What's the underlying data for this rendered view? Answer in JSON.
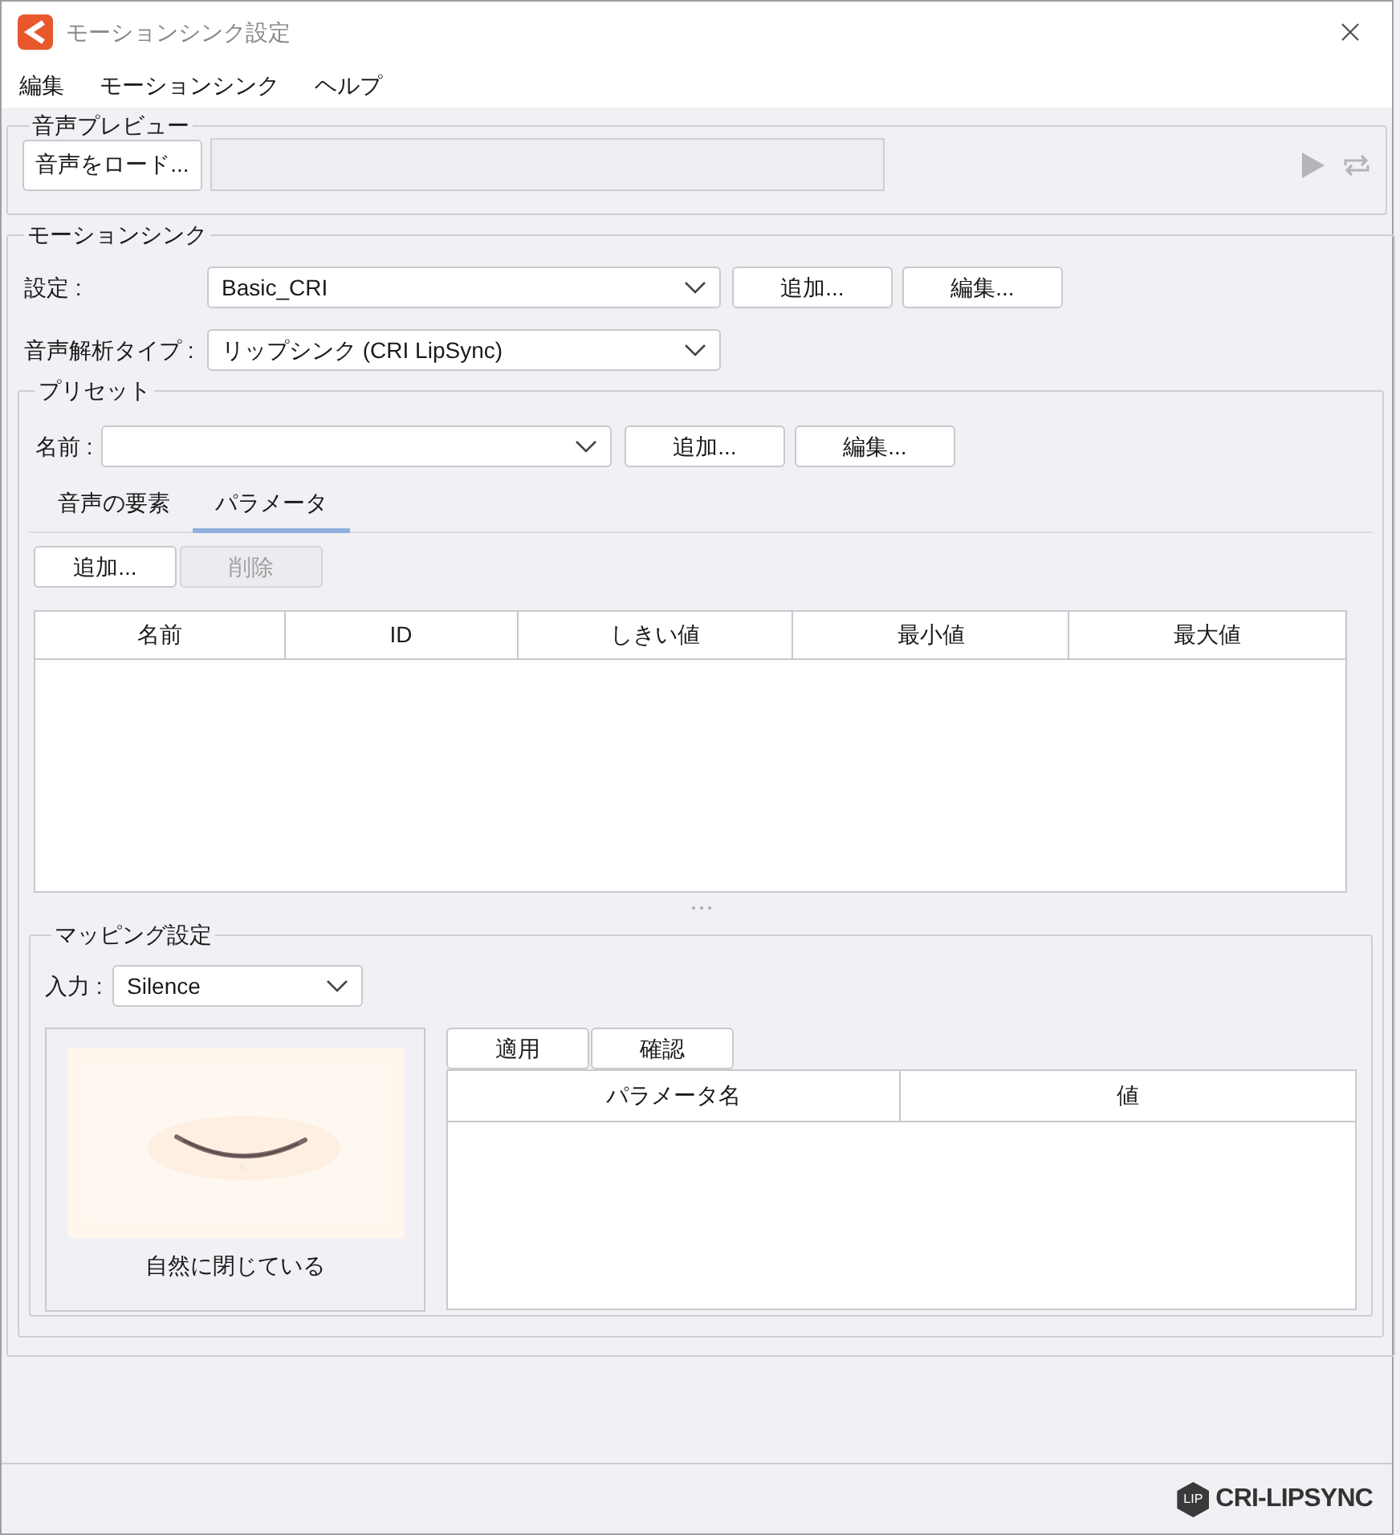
{
  "window": {
    "title": "モーションシンク設定"
  },
  "menu": [
    {
      "label": "編集"
    },
    {
      "label": "モーションシンク"
    },
    {
      "label": "ヘルプ"
    }
  ],
  "audio_preview": {
    "title": "音声プレビュー",
    "load_button": "音声をロード..."
  },
  "motion_sync": {
    "title": "モーションシンク",
    "settings": {
      "label": "設定 :",
      "value": "Basic_CRI",
      "buttons": [
        "追加...",
        "編集..."
      ]
    },
    "analysis_type": {
      "label": "音声解析タイプ :",
      "value": "リップシンク (CRI LipSync)"
    },
    "preset": {
      "title": "プリセット",
      "name_label": "名前 :",
      "buttons": [
        "追加...",
        "編集..."
      ],
      "tabs": [
        {
          "label": "音声の要素",
          "selected": false
        },
        {
          "label": "パラメータ",
          "selected": true
        }
      ],
      "actions": [
        {
          "label": "追加...",
          "disabled": false
        },
        {
          "label": "削除",
          "disabled": true
        }
      ],
      "table": {
        "columns": [
          "名前",
          "ID",
          "しきい値",
          "最小値",
          "最大値"
        ]
      },
      "mapping": {
        "title": "マッピング設定",
        "input_label": "入力 :",
        "input_value": "Silence",
        "preview_caption": "自然に閉じている",
        "buttons": [
          "適用",
          "確認"
        ],
        "table": {
          "columns": [
            "パラメータ名",
            "値"
          ]
        }
      }
    }
  },
  "logo": {
    "badge": "LIP",
    "text": "CRI-LIPSYNC"
  }
}
